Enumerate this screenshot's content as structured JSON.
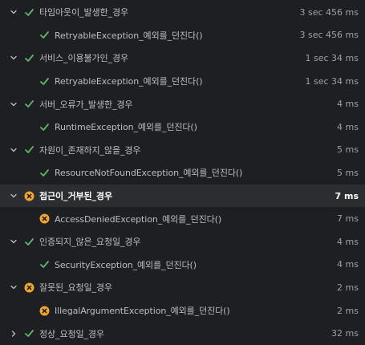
{
  "colors": {
    "background": "#1e1f22",
    "selected_row": "#2b2d30",
    "pass_green": "#5fb865",
    "fail_orange": "#f0a732",
    "text": "#bcbec4",
    "time_text": "#9da0a8"
  },
  "groups": [
    {
      "label": "타임아웃이_발생한_경우",
      "time": "3 sec 456 ms",
      "status": "passed",
      "expanded": true,
      "selected": false,
      "children": [
        {
          "label": "RetryableException_예외를_던진다()",
          "time": "3 sec 456 ms",
          "status": "passed"
        }
      ]
    },
    {
      "label": "서비스_이용불가인_경우",
      "time": "1 sec 34 ms",
      "status": "passed",
      "expanded": true,
      "selected": false,
      "children": [
        {
          "label": "RetryableException_예외를_던진다()",
          "time": "1 sec 34 ms",
          "status": "passed"
        }
      ]
    },
    {
      "label": "서버_오류가_발생한_경우",
      "time": "4 ms",
      "status": "passed",
      "expanded": true,
      "selected": false,
      "children": [
        {
          "label": "RuntimeException_예외를_던진다()",
          "time": "4 ms",
          "status": "passed"
        }
      ]
    },
    {
      "label": "자원이_존재하지_않을_경우",
      "time": "5 ms",
      "status": "passed",
      "expanded": true,
      "selected": false,
      "children": [
        {
          "label": "ResourceNotFoundException_예외를_던진다()",
          "time": "5 ms",
          "status": "passed"
        }
      ]
    },
    {
      "label": "접근이_거부된_경우",
      "time": "7 ms",
      "status": "failed",
      "expanded": true,
      "selected": true,
      "children": [
        {
          "label": "AccessDeniedException_예외를_던진다()",
          "time": "7 ms",
          "status": "failed"
        }
      ]
    },
    {
      "label": "인증되지_않은_요청일_경우",
      "time": "4 ms",
      "status": "passed",
      "expanded": true,
      "selected": false,
      "children": [
        {
          "label": "SecurityException_예외를_던진다()",
          "time": "4 ms",
          "status": "passed"
        }
      ]
    },
    {
      "label": "잘못된_요청일_경우",
      "time": "2 ms",
      "status": "failed",
      "expanded": true,
      "selected": false,
      "children": [
        {
          "label": "IllegalArgumentException_예외를_던진다()",
          "time": "2 ms",
          "status": "failed"
        }
      ]
    },
    {
      "label": "정상_요청일_경우",
      "time": "32 ms",
      "status": "passed",
      "expanded": false,
      "selected": false,
      "children": []
    }
  ]
}
